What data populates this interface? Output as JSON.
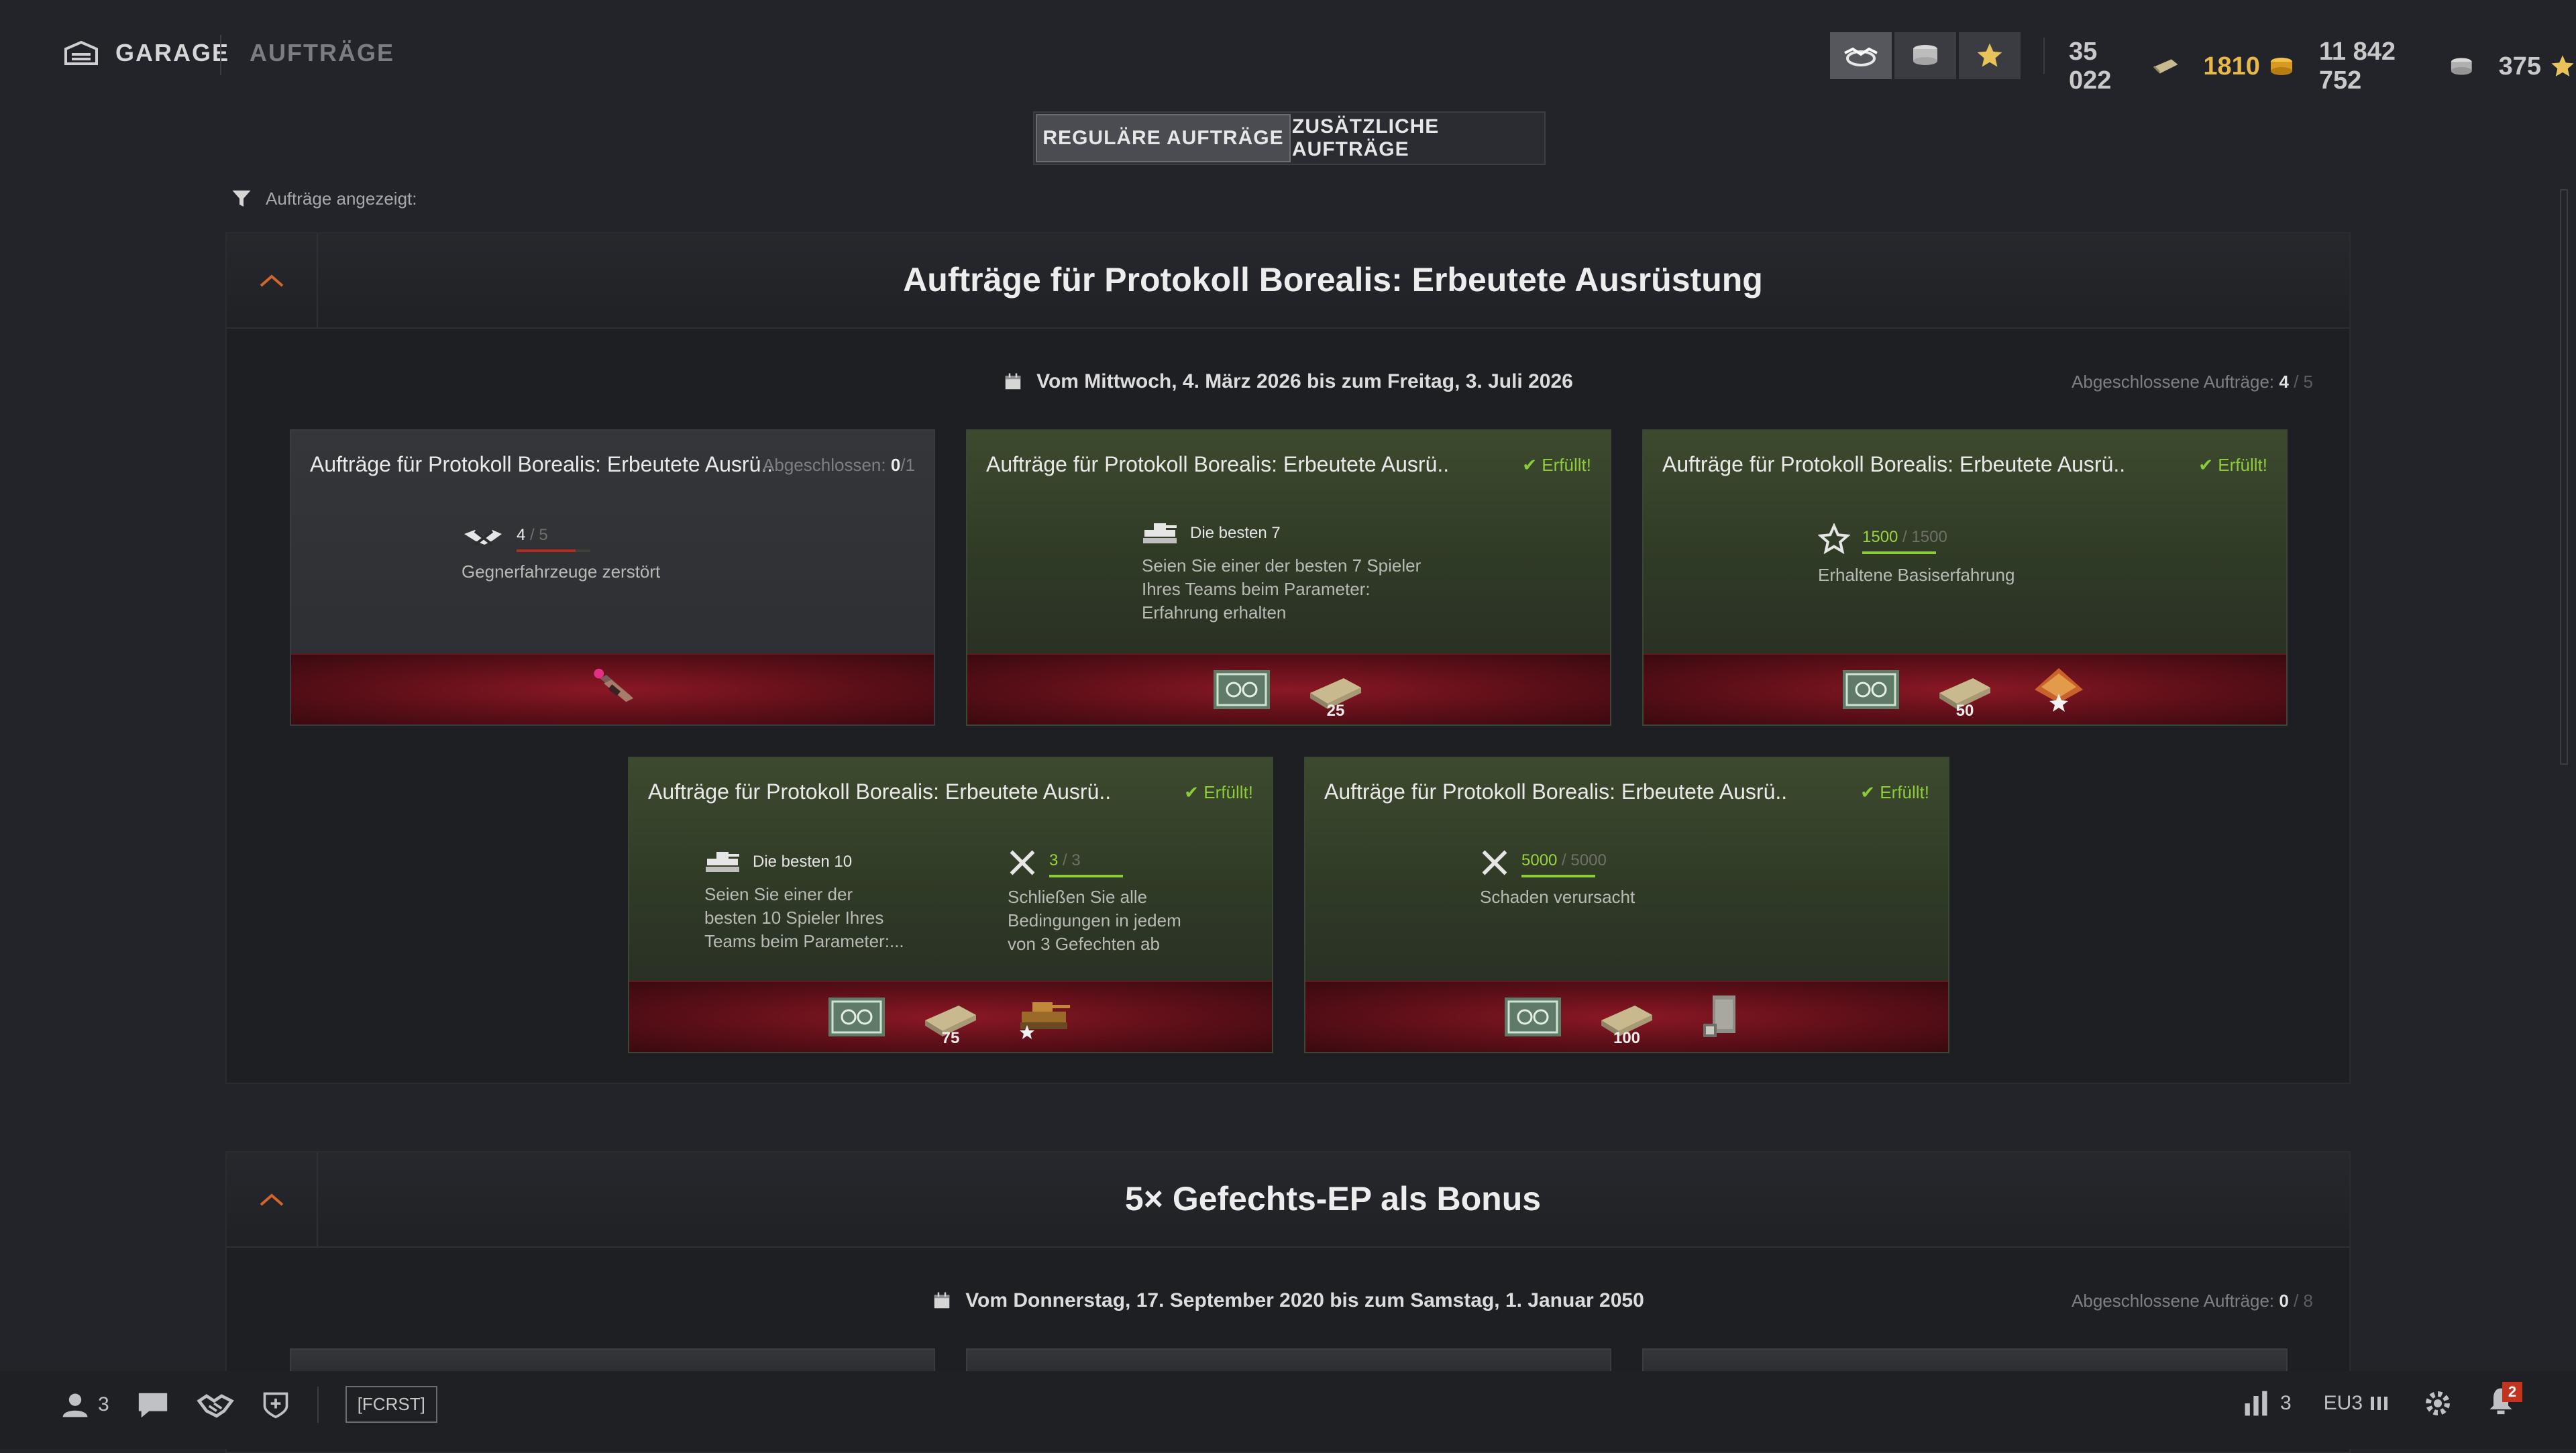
{
  "nav": {
    "garage": "GARAGE",
    "auftraege": "AUFTRÄGE"
  },
  "balances": {
    "bonds": "35 022",
    "gold": "1810",
    "credits": "11 842 752",
    "free_xp": "375"
  },
  "tabs": {
    "regular": "REGULÄRE AUFTRÄGE",
    "additional": "ZUSÄTZLICHE AUFTRÄGE"
  },
  "filter": {
    "label": "Aufträge angezeigt:"
  },
  "sections": [
    {
      "title": "Aufträge für Protokoll Borealis: Erbeutete Ausrüstung",
      "date": "Vom Mittwoch, 4. März 2026 bis zum Freitag, 3. Juli 2026",
      "count_label": "Abgeschlossene Aufträge:",
      "count_done": "4",
      "count_sep": " / ",
      "count_total": "5",
      "cards": [
        {
          "title": "Aufträge für Protokoll Borealis: Erbeutete Ausrü..",
          "status_label": "Abgeschlossen:",
          "status_done": "0",
          "status_total": "/1",
          "cond_value": "4",
          "cond_total": "5",
          "progress": 0.8,
          "cond_text": "Gegnerfahrzeuge zerstört",
          "reward_count": ""
        },
        {
          "title": "Aufträge für Protokoll Borealis: Erbeutete Ausrü..",
          "status": "✔ Erfüllt!",
          "cond_head": "Die besten 7",
          "cond_text": "Seien Sie einer der besten 7 Spieler Ihres Teams beim Parameter: Erfahrung erhalten",
          "reward_count": "25"
        },
        {
          "title": "Aufträge für Protokoll Borealis: Erbeutete Ausrü..",
          "status": "✔ Erfüllt!",
          "cond_value": "1500",
          "cond_total": "1500",
          "progress": 1,
          "cond_text": "Erhaltene Basiserfahrung",
          "reward_count": "50"
        },
        {
          "title": "Aufträge für Protokoll Borealis: Erbeutete Ausrü..",
          "status": "✔ Erfüllt!",
          "cond_head": "Die besten 10",
          "cond_text": "Seien Sie einer der besten 10 Spieler Ihres Teams beim Parameter:...",
          "cond2_value": "3",
          "cond2_total": "3",
          "progress2": 1,
          "cond2_text": "Schließen Sie alle Bedingungen in jedem von 3 Gefechten ab",
          "reward_count": "75"
        },
        {
          "title": "Aufträge für Protokoll Borealis: Erbeutete Ausrü..",
          "status": "✔ Erfüllt!",
          "cond_value": "5000",
          "cond_total": "5000",
          "progress": 1,
          "cond_text": "Schaden verursacht",
          "reward_count": "100"
        }
      ]
    },
    {
      "title": "5× Gefechts-EP als Bonus",
      "date": "Vom Donnerstag, 17. September 2020 bis zum Samstag, 1. Januar 2050",
      "count_label": "Abgeschlossene Aufträge:",
      "count_done": "0",
      "count_sep": " / ",
      "count_total": "8"
    }
  ],
  "sep": " / ",
  "bottom": {
    "platoon_count": "3",
    "clan_tag": "[FCRST]",
    "sessions_count": "3",
    "server": "EU3",
    "notifications": "2"
  },
  "colors": {
    "accent_green": "#8ccc3c",
    "gold": "#e8b94a",
    "reward_red": "#8a1824",
    "chevron_orange": "#d0662c"
  }
}
